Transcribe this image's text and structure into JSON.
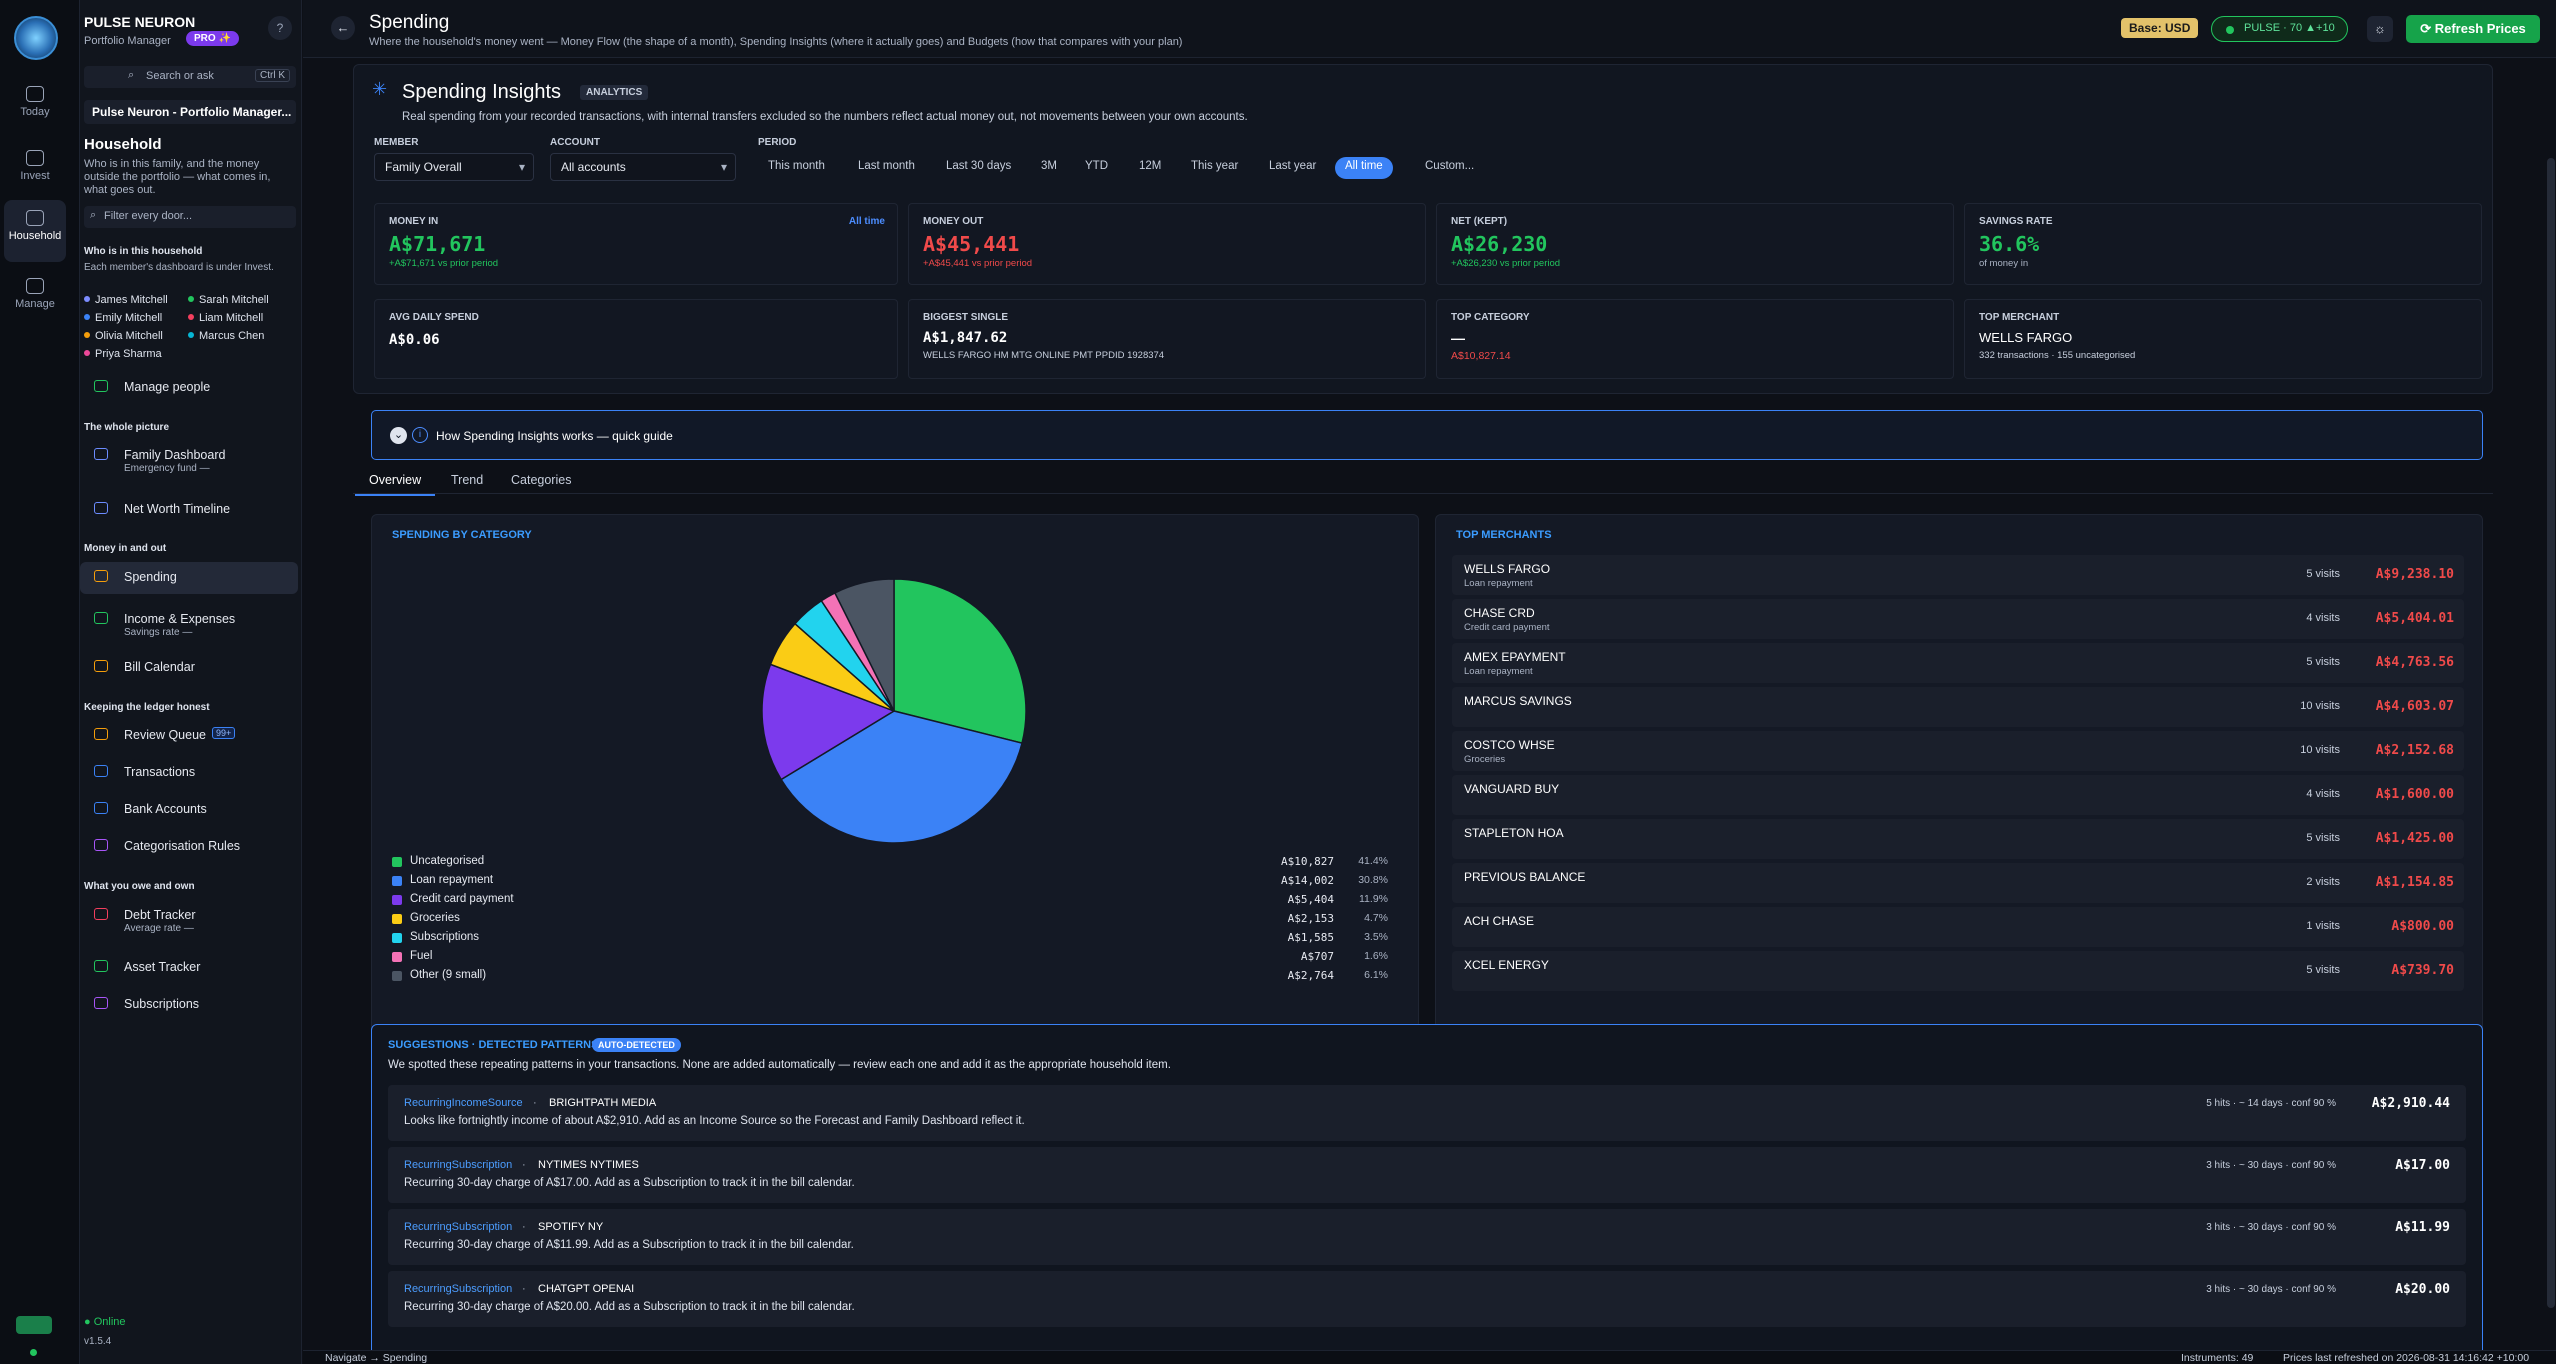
{
  "app": {
    "name": "PULSE NEURON",
    "subtitle": "Portfolio Manager",
    "pro_badge": "PRO ✨",
    "help": "?",
    "search_label": "Search or ask",
    "search_kbd": "Ctrl K",
    "workspace": "Pulse Neuron - Portfolio Manager...",
    "online": "Online",
    "version": "v1.5.4"
  },
  "rail": [
    {
      "label": "Today",
      "icon": "calendar-icon"
    },
    {
      "label": "Invest",
      "icon": "chart-icon"
    },
    {
      "label": "Household",
      "icon": "people-icon",
      "active": true
    },
    {
      "label": "Manage",
      "icon": "gear-icon"
    }
  ],
  "sidebar": {
    "title": "Household",
    "desc": "Who is in this family, and the money outside the portfolio — what comes in, what goes out.",
    "filter_placeholder": "Filter every door...",
    "members_title": "Who is in this household",
    "members_note": "Each member's dashboard is under Invest.",
    "members": [
      {
        "name": "James Mitchell",
        "color": "#7c8cff"
      },
      {
        "name": "Sarah Mitchell",
        "color": "#22c55e"
      },
      {
        "name": "Emily Mitchell",
        "color": "#3b82f6"
      },
      {
        "name": "Liam Mitchell",
        "color": "#f43f5e"
      },
      {
        "name": "Olivia Mitchell",
        "color": "#f59e0b"
      },
      {
        "name": "Marcus Chen",
        "color": "#06b6d4"
      },
      {
        "name": "Priya Sharma",
        "color": "#ec4899"
      }
    ],
    "manage_people": "Manage people",
    "groups": {
      "whole": "The whole picture",
      "money": "Money in and out",
      "ledger": "Keeping the ledger honest",
      "owe": "What you owe and own"
    },
    "family_dashboard": {
      "label": "Family Dashboard",
      "sub": "Emergency fund —"
    },
    "net_worth": "Net Worth Timeline",
    "spending": "Spending",
    "income": {
      "label": "Income & Expenses",
      "sub": "Savings rate —"
    },
    "bill_calendar": "Bill Calendar",
    "review_queue": {
      "label": "Review Queue",
      "badge": "99+"
    },
    "transactions": "Transactions",
    "bank_accounts": "Bank Accounts",
    "cat_rules": "Categorisation Rules",
    "debt": {
      "label": "Debt Tracker",
      "sub": "Average rate —"
    },
    "asset": "Asset Tracker",
    "subscriptions": "Subscriptions"
  },
  "header": {
    "title": "Spending",
    "subtitle": "Where the household's money went — Money Flow (the shape of a month), Spending Insights (where it actually goes) and Budgets (how that compares with your plan)",
    "base": "Base: USD",
    "pulse": "PULSE · 70  ▲+10",
    "refresh": "⟳ Refresh Prices"
  },
  "insights": {
    "title": "Spending Insights",
    "tag": "ANALYTICS",
    "desc": "Real spending from your recorded transactions, with internal transfers excluded so the numbers reflect actual money out, not movements between your own accounts.",
    "member_label": "MEMBER",
    "member_value": "Family Overall",
    "account_label": "ACCOUNT",
    "account_value": "All accounts",
    "period_label": "PERIOD",
    "periods": [
      "This month",
      "Last month",
      "Last 30 days",
      "3M",
      "YTD",
      "12M",
      "This year",
      "Last year",
      "All time",
      "Custom..."
    ],
    "active_period": 8
  },
  "kpis": {
    "money_in": {
      "label": "MONEY IN",
      "value": "A$71,671",
      "sub": "+A$71,671 vs prior period",
      "tag": "All time"
    },
    "money_out": {
      "label": "MONEY OUT",
      "value": "A$45,441",
      "sub": "+A$45,441 vs prior period"
    },
    "net": {
      "label": "NET (KEPT)",
      "value": "A$26,230",
      "sub": "+A$26,230 vs prior period"
    },
    "savings": {
      "label": "SAVINGS RATE",
      "value": "36.6%",
      "sub": "of money in"
    },
    "avg": {
      "label": "AVG DAILY SPEND",
      "value": "A$0.06"
    },
    "biggest": {
      "label": "BIGGEST SINGLE",
      "value": "A$1,847.62",
      "sub": "WELLS FARGO HM MTG ONLINE PMT PPDID 1928374"
    },
    "top_cat": {
      "label": "TOP CATEGORY",
      "value": "—",
      "sub": "A$10,827.14"
    },
    "top_merchant": {
      "label": "TOP MERCHANT",
      "value": "WELLS FARGO",
      "sub": "332 transactions · 155 uncategorised"
    }
  },
  "guide": {
    "text": "How Spending Insights works — quick guide"
  },
  "tabs": [
    "Overview",
    "Trend",
    "Categories"
  ],
  "chart_data": {
    "type": "pie",
    "title": "SPENDING BY CATEGORY",
    "slices": [
      {
        "label": "Uncategorised",
        "value": 10827,
        "display": "A$10,827",
        "pct": "41.4%",
        "color": "#22c55e"
      },
      {
        "label": "Loan repayment",
        "value": 14002,
        "display": "A$14,002",
        "pct": "30.8%",
        "color": "#3b82f6"
      },
      {
        "label": "Credit card payment",
        "value": 5404,
        "display": "A$5,404",
        "pct": "11.9%",
        "color": "#7c3aed"
      },
      {
        "label": "Groceries",
        "value": 2153,
        "display": "A$2,153",
        "pct": "4.7%",
        "color": "#facc15"
      },
      {
        "label": "Subscriptions",
        "value": 1585,
        "display": "A$1,585",
        "pct": "3.5%",
        "color": "#22d3ee"
      },
      {
        "label": "Fuel",
        "value": 707,
        "display": "A$707",
        "pct": "1.6%",
        "color": "#f472b6"
      },
      {
        "label": "Other (9 small)",
        "value": 2764,
        "display": "A$2,764",
        "pct": "6.1%",
        "color": "#4b5563"
      }
    ]
  },
  "merchants": {
    "title": "TOP MERCHANTS",
    "items": [
      {
        "name": "WELLS FARGO",
        "sub": "Loan repayment",
        "visits": "5 visits",
        "amount": "A$9,238.10"
      },
      {
        "name": "CHASE CRD",
        "sub": "Credit card payment",
        "visits": "4 visits",
        "amount": "A$5,404.01"
      },
      {
        "name": "AMEX EPAYMENT",
        "sub": "Loan repayment",
        "visits": "5 visits",
        "amount": "A$4,763.56"
      },
      {
        "name": "MARCUS SAVINGS",
        "sub": "",
        "visits": "10 visits",
        "amount": "A$4,603.07"
      },
      {
        "name": "COSTCO WHSE",
        "sub": "Groceries",
        "visits": "10 visits",
        "amount": "A$2,152.68"
      },
      {
        "name": "VANGUARD BUY",
        "sub": "",
        "visits": "4 visits",
        "amount": "A$1,600.00"
      },
      {
        "name": "STAPLETON HOA",
        "sub": "",
        "visits": "5 visits",
        "amount": "A$1,425.00"
      },
      {
        "name": "PREVIOUS BALANCE",
        "sub": "",
        "visits": "2 visits",
        "amount": "A$1,154.85"
      },
      {
        "name": "ACH CHASE",
        "sub": "",
        "visits": "1 visits",
        "amount": "A$800.00"
      },
      {
        "name": "XCEL ENERGY",
        "sub": "",
        "visits": "5 visits",
        "amount": "A$739.70"
      }
    ]
  },
  "suggestions": {
    "title": "SUGGESTIONS · DETECTED PATTERNS",
    "auto": "AUTO-DETECTED",
    "desc": "We spotted these repeating patterns in your transactions. None are added automatically — review each one and add it as the appropriate household item.",
    "items": [
      {
        "type": "RecurringIncomeSource",
        "merchant": "BRIGHTPATH MEDIA",
        "desc": "Looks like fortnightly income of about A$2,910. Add as an Income Source so the Forecast and Family Dashboard reflect it.",
        "hits": "5 hits · ~ 14 days · conf 90 %",
        "amount": "A$2,910.44"
      },
      {
        "type": "RecurringSubscription",
        "merchant": "NYTIMES NYTIMES",
        "desc": "Recurring 30-day charge of A$17.00. Add as a Subscription to track it in the bill calendar.",
        "hits": "3 hits · ~ 30 days · conf 90 %",
        "amount": "A$17.00"
      },
      {
        "type": "RecurringSubscription",
        "merchant": "SPOTIFY NY",
        "desc": "Recurring 30-day charge of A$11.99. Add as a Subscription to track it in the bill calendar.",
        "hits": "3 hits · ~ 30 days · conf 90 %",
        "amount": "A$11.99"
      },
      {
        "type": "RecurringSubscription",
        "merchant": "CHATGPT OPENAI",
        "desc": "Recurring 30-day charge of A$20.00. Add as a Subscription to track it in the bill calendar.",
        "hits": "3 hits · ~ 30 days · conf 90 %",
        "amount": "A$20.00"
      }
    ]
  },
  "status": {
    "nav": "Navigate → Spending",
    "instruments": "Instruments: 49",
    "prices": "Prices last refreshed on 2026-08-31 14:16:42 +10:00"
  }
}
